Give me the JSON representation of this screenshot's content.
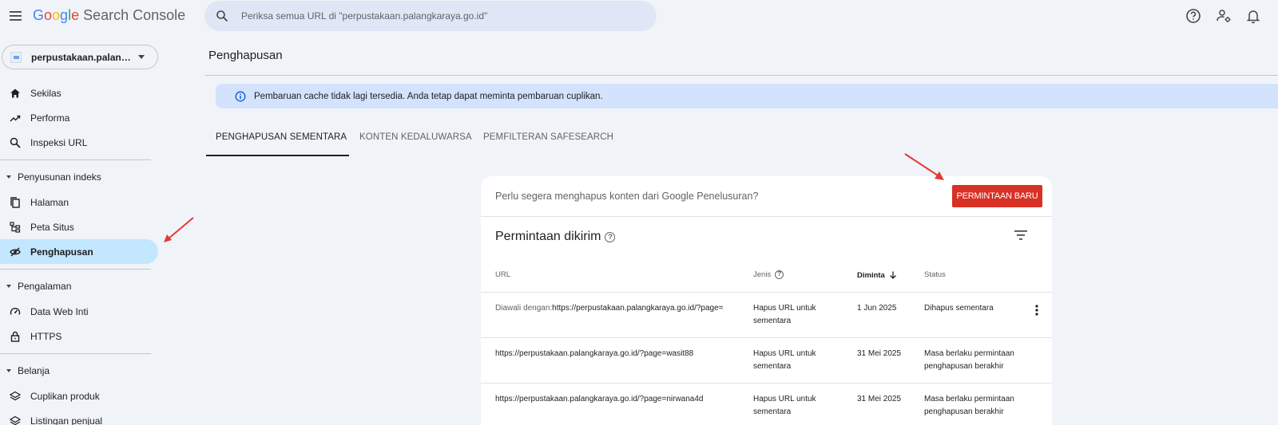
{
  "app": {
    "logo_letters": [
      "G",
      "o",
      "o",
      "g",
      "l",
      "e"
    ],
    "product": "Search Console"
  },
  "search": {
    "placeholder": "Periksa semua URL di \"perpustakaan.palangkaraya.go.id\""
  },
  "topbar_icons": [
    "help-icon",
    "admin-settings-icon",
    "notifications-icon"
  ],
  "sidebar": {
    "property": "perpustakaan.palangkaraya.go.id",
    "items_top": [
      {
        "label": "Sekilas",
        "icon": "home-icon"
      },
      {
        "label": "Performa",
        "icon": "trending-icon"
      },
      {
        "label": "Inspeksi URL",
        "icon": "search-icon"
      }
    ],
    "section_index": "Penyusunan indeks",
    "items_index": [
      {
        "label": "Halaman",
        "icon": "pages-icon"
      },
      {
        "label": "Peta Situs",
        "icon": "sitemap-icon"
      },
      {
        "label": "Penghapusan",
        "icon": "visibility-off-icon",
        "active": true
      }
    ],
    "section_experience": "Pengalaman",
    "items_experience": [
      {
        "label": "Data Web Inti",
        "icon": "speed-icon"
      },
      {
        "label": "HTTPS",
        "icon": "lock-icon"
      }
    ],
    "section_shopping": "Belanja",
    "items_shopping": [
      {
        "label": "Cuplikan produk",
        "icon": "layers-icon"
      },
      {
        "label": "Listingan penjual",
        "icon": "layers-icon"
      }
    ]
  },
  "main": {
    "title": "Penghapusan",
    "banner": "Pembaruan cache tidak lagi tersedia. Anda tetap dapat meminta pembaruan cuplikan.",
    "tabs": [
      {
        "label": "PENGHAPUSAN SEMENTARA",
        "active": true
      },
      {
        "label": "KONTEN KEDALUWARSA"
      },
      {
        "label": "PEMFILTERAN SAFESEARCH"
      }
    ],
    "card": {
      "question": "Perlu segera menghapus konten dari Google Penelusuran?",
      "new_request_button": "PERMINTAAN BARU",
      "title": "Permintaan dikirim",
      "columns": [
        "URL",
        "Jenis",
        "Diminta",
        "Status"
      ],
      "rows": [
        {
          "url_prefix": "Diawali dengan:",
          "url": "https://perpustakaan.palangkaraya.go.id/?page=",
          "type_line1": "Hapus URL untuk",
          "type_line2": "sementara",
          "date": "1 Jun 2025",
          "status_line1": "Dihapus sementara",
          "status_line2": ""
        },
        {
          "url_prefix": "",
          "url": "https://perpustakaan.palangkaraya.go.id/?page=wasit88",
          "type_line1": "Hapus URL untuk",
          "type_line2": "sementara",
          "date": "31 Mei 2025",
          "status_line1": "Masa berlaku permintaan",
          "status_line2": "penghapusan berakhir"
        },
        {
          "url_prefix": "",
          "url": "https://perpustakaan.palangkaraya.go.id/?page=nirwana4d",
          "type_line1": "Hapus URL untuk",
          "type_line2": "sementara",
          "date": "31 Mei 2025",
          "status_line1": "Masa berlaku permintaan",
          "status_line2": "penghapusan berakhir"
        }
      ]
    }
  },
  "colors": {
    "background": "#f0f4f9",
    "active_nav": "#c2e7ff",
    "banner": "#d3e3fd",
    "primary_button": "#d93025",
    "annotation_arrow": "#e53935"
  }
}
